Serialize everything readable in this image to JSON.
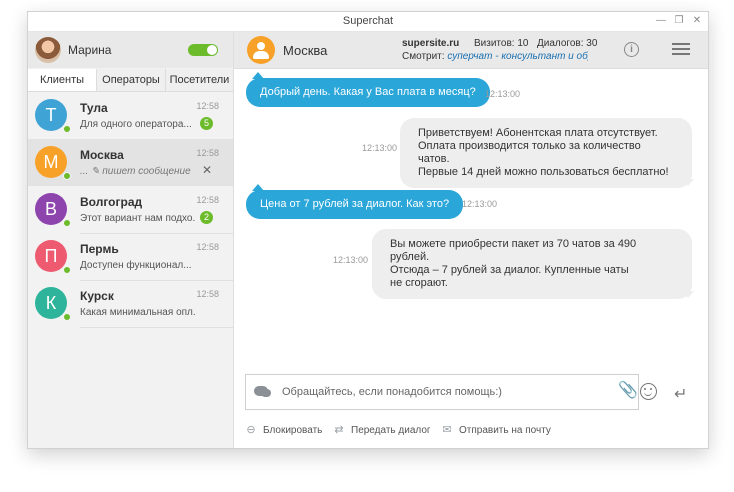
{
  "window": {
    "title": "Superchat"
  },
  "user": {
    "name": "Марина",
    "online": true
  },
  "tabs": [
    "Клиенты",
    "Операторы",
    "Посетители"
  ],
  "clients": [
    {
      "initial": "Т",
      "name": "Тула",
      "time": "12:58",
      "preview": "Для одного оператора...",
      "badge": "5",
      "color": "#3fa3d6"
    },
    {
      "initial": "М",
      "name": "Москва",
      "time": "12:58",
      "preview": "... ✎ пишет сообщение",
      "badge": "",
      "color": "#f7a128",
      "typing": true
    },
    {
      "initial": "В",
      "name": "Волгоград",
      "time": "12:58",
      "preview": "Этот вариант нам подхо...",
      "badge": "2",
      "color": "#8e44ad"
    },
    {
      "initial": "П",
      "name": "Пермь",
      "time": "12:58",
      "preview": "Доступен функционал...",
      "badge": "",
      "color": "#ee5a6f"
    },
    {
      "initial": "К",
      "name": "Курск",
      "time": "12:58",
      "preview": "Какая минимальная опл...",
      "badge": "",
      "color": "#2db49a"
    }
  ],
  "chat": {
    "name": "Москва",
    "site": "supersite.ru",
    "visits": "Визитов: 10",
    "dialogs": "Диалогов: 30",
    "watching_label": "Смотрит:",
    "watching_link": "суперчат - консультант и обр..."
  },
  "messages": [
    {
      "dir": "out",
      "text": "Добрый день. Какая у Вас плата в месяц?",
      "time": "12:13:00"
    },
    {
      "dir": "in",
      "lines": [
        "Приветствуем! Абонентская плата отсутствует.",
        "Оплата производится только за количество чатов.",
        "Первые 14 дней можно пользоваться бесплатно!"
      ],
      "time": "12:13:00"
    },
    {
      "dir": "out",
      "text": "Цена от 7 рублей за диалог. Как это?",
      "time": "12:13:00"
    },
    {
      "dir": "in",
      "lines": [
        "Вы можете приобрести пакет из 70 чатов за 490 рублей.",
        "Отсюда – 7 рублей за диалог. Купленные чаты",
        "не сгорают."
      ],
      "time": "12:13:00"
    }
  ],
  "input": {
    "placeholder": "Обращайтесь, если понадобится помощь:)"
  },
  "actions": {
    "block": "Блокировать",
    "transfer": "Передать диалог",
    "email": "Отправить на почту"
  },
  "colors": {
    "accent": "#2aa6d9",
    "online": "#6cbb2b",
    "incoming_bg": "#eeeeee"
  }
}
